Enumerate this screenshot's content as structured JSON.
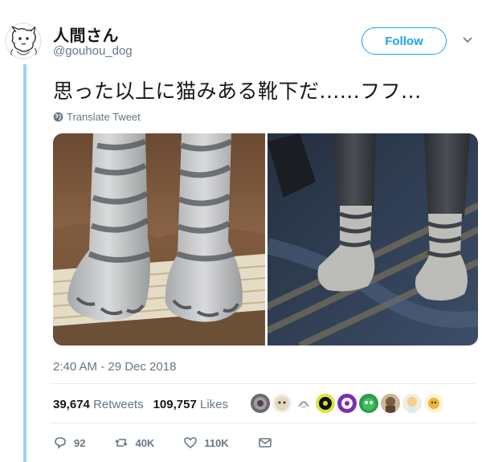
{
  "user": {
    "display_name": "人間さん",
    "handle": "@gouhou_dog"
  },
  "follow_label": "Follow",
  "tweet": {
    "text": "思った以上に猫みある靴下だ......フフ...",
    "translate_label": "Translate Tweet",
    "timestamp": "2:40 AM - 29 Dec 2018"
  },
  "stats": {
    "retweets_count": "39,674",
    "retweets_label": "Retweets",
    "likes_count": "109,757",
    "likes_label": "Likes"
  },
  "actions": {
    "reply_count": "92",
    "retweet_count": "40K",
    "like_count": "110K"
  },
  "icons": {
    "avatar": "dog-sketch-avatar",
    "menu": "chevron-down-icon",
    "translate": "globe-icon",
    "reply": "reply-icon",
    "retweet": "retweet-icon",
    "like": "heart-icon",
    "message": "envelope-icon"
  },
  "colors": {
    "accent": "#1da1f2",
    "thread_line": "#9fd0f3",
    "secondary_text": "#657786",
    "primary_text": "#14171a"
  }
}
